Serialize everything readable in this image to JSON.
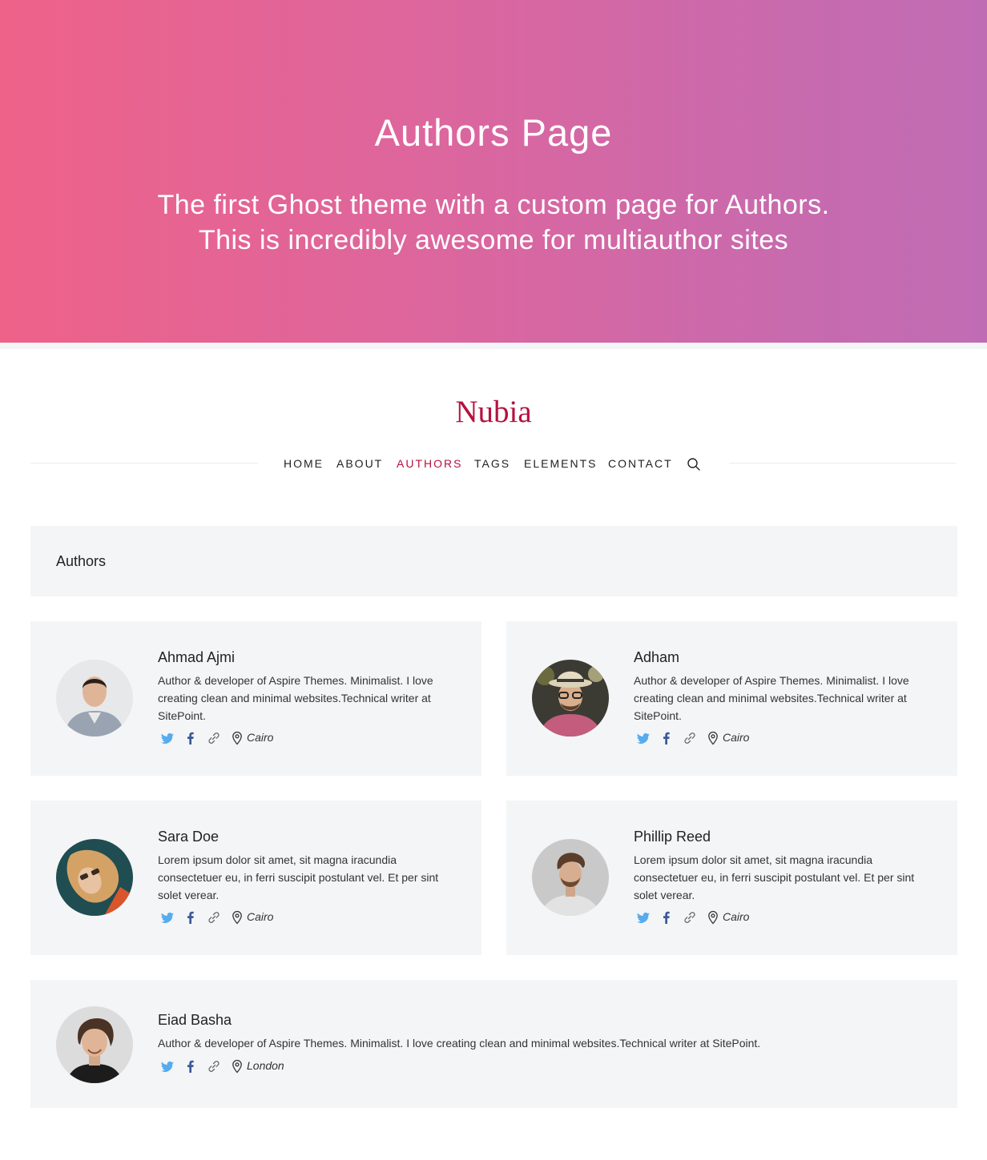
{
  "hero": {
    "title": "Authors Page",
    "subtitle_line1": "The first Ghost theme with a custom page for Authors.",
    "subtitle_line2": "This is incredibly awesome for multiauthor sites"
  },
  "brand": {
    "logo": "Nubia",
    "accent": "#b5123f"
  },
  "nav": {
    "items": [
      {
        "label": "HOME"
      },
      {
        "label": "ABOUT"
      },
      {
        "label": "AUTHORS"
      },
      {
        "label": "TAGS"
      },
      {
        "label": "ELEMENTS"
      },
      {
        "label": "CONTACT"
      }
    ],
    "active": "AUTHORS",
    "search_icon": "search-icon"
  },
  "section": {
    "title": "Authors"
  },
  "authors": [
    {
      "name": "Ahmad Ajmi",
      "bio_lines": [
        "Author & developer of Aspire Themes. Minimalist. I love",
        "creating clean and minimal websites.Technical writer at",
        "SitePoint."
      ],
      "location": "Cairo",
      "icons": [
        "twitter-icon",
        "facebook-icon",
        "link-icon",
        "location-icon"
      ]
    },
    {
      "name": "Adham",
      "bio_lines": [
        "Author & developer of Aspire Themes. Minimalist. I love",
        "creating clean and minimal websites.Technical writer at",
        "SitePoint."
      ],
      "location": "Cairo",
      "icons": [
        "twitter-icon",
        "facebook-icon",
        "link-icon",
        "location-icon"
      ]
    },
    {
      "name": "Sara Doe",
      "bio_lines": [
        "Lorem ipsum dolor sit amet, sit magna iracundia",
        "consectetuer eu, in ferri suscipit postulant vel. Et per sint",
        "solet verear."
      ],
      "location": "Cairo",
      "icons": [
        "twitter-icon",
        "facebook-icon",
        "link-icon",
        "location-icon"
      ]
    },
    {
      "name": "Phillip Reed",
      "bio_lines": [
        "Lorem ipsum dolor sit amet, sit magna iracundia",
        "consectetuer eu, in ferri suscipit postulant vel. Et per sint",
        "solet verear."
      ],
      "location": "Cairo",
      "icons": [
        "twitter-icon",
        "facebook-icon",
        "link-icon",
        "location-icon"
      ]
    },
    {
      "name": "Eiad Basha",
      "bio_lines": [
        "Author & developer of Aspire Themes. Minimalist. I love creating clean and minimal websites.Technical writer at SitePoint."
      ],
      "location": "London",
      "icons": [
        "twitter-icon",
        "facebook-icon",
        "link-icon",
        "location-icon"
      ]
    }
  ],
  "colors": {
    "twitter": "#55acee",
    "facebook": "#3b5998",
    "card_bg": "#f4f5f7",
    "gradient_start": "#ee6289",
    "gradient_end": "#c06cb4"
  }
}
